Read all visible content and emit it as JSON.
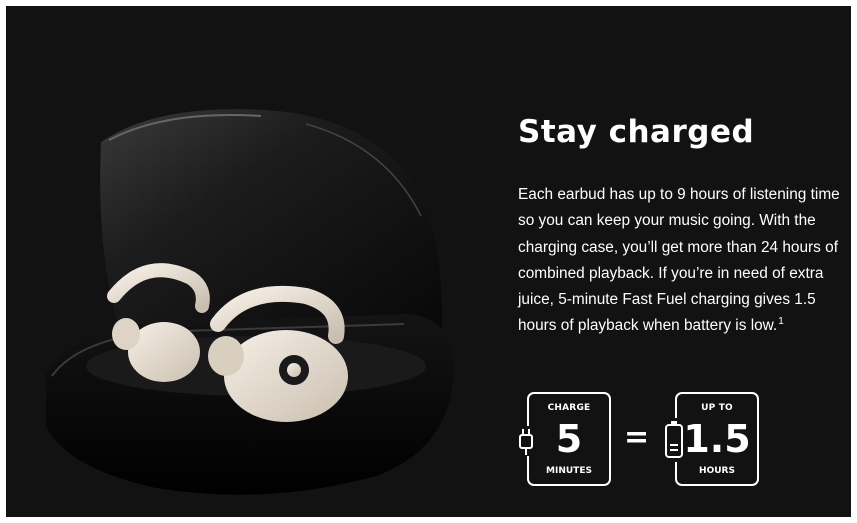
{
  "section": {
    "headline": "Stay charged",
    "body_main": "Each earbud has up to 9 hours of listening time so you can keep your music going. With the charging case, you’ll get more than 24 hours of combined playback. If you’re in need of extra juice, 5-minute Fast Fuel charging gives 1.5 hours of playback when battery is low.",
    "footnote_ref": "1"
  },
  "badges": {
    "charge": {
      "caption": "CHARGE",
      "value": "5",
      "unit": "MINUTES"
    },
    "equals": "=",
    "result": {
      "caption": "UP TO",
      "value": "1.5",
      "unit": "HOURS"
    }
  },
  "icons": {
    "charge": "power-plug-icon",
    "result": "battery-icon"
  },
  "colors": {
    "background": "#121212",
    "text": "#ffffff",
    "earbuds": "#ece3d6",
    "case": "#050505"
  }
}
